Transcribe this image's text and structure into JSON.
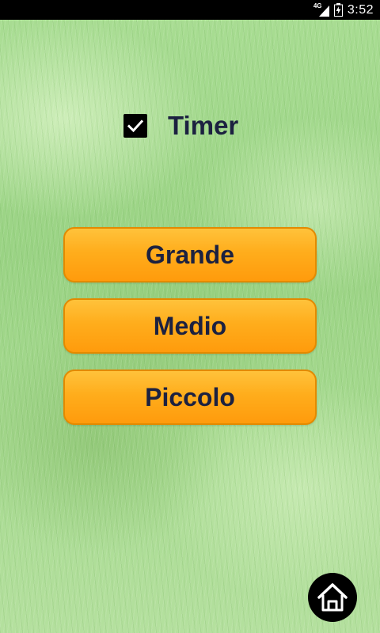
{
  "status_bar": {
    "network_type": "4G",
    "time": "3:52"
  },
  "timer": {
    "label": "Timer",
    "checked": true
  },
  "size_buttons": [
    {
      "label": "Grande"
    },
    {
      "label": "Medio"
    },
    {
      "label": "Piccolo"
    }
  ],
  "icons": {
    "signal": "signal-icon",
    "battery": "battery-charging-icon",
    "checkbox": "checkmark-icon",
    "home": "home-icon"
  },
  "colors": {
    "button_fill": "#ffad1c",
    "button_border": "#e38a00",
    "text": "#1c2140",
    "home_button": "#000000"
  }
}
